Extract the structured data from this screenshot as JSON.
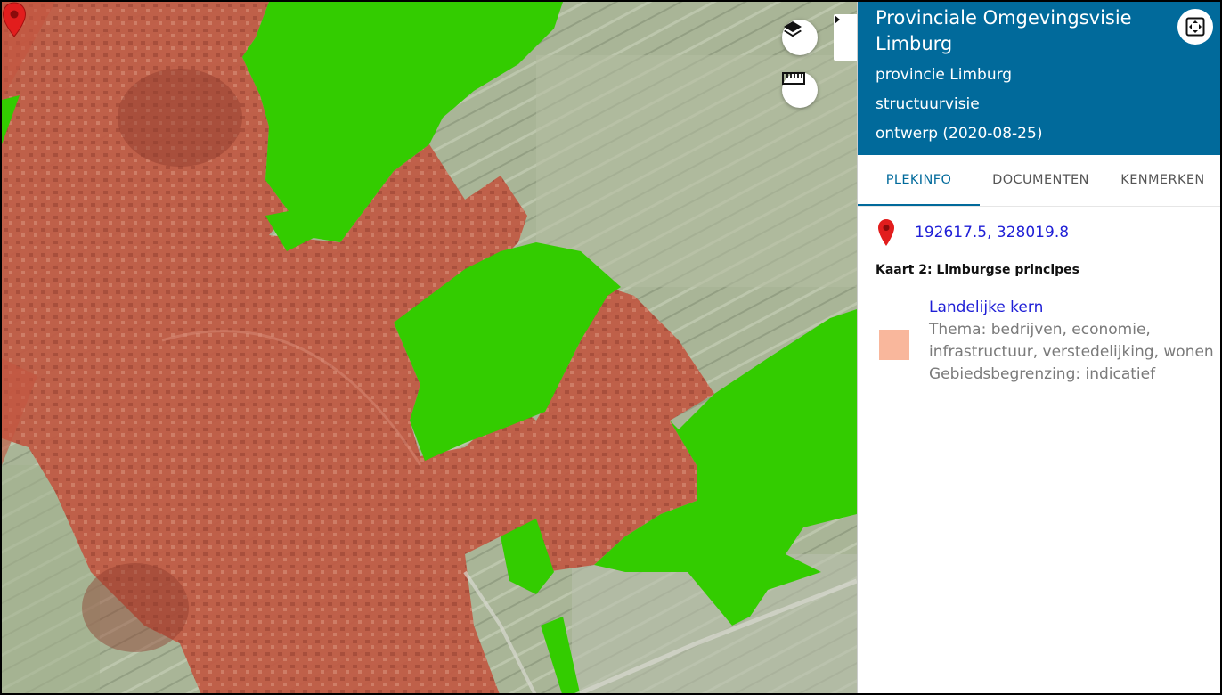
{
  "panel": {
    "title": "Provinciale Omgevingsvisie Limburg",
    "owner": "provincie Limburg",
    "type": "structuurvisie",
    "status": "ontwerp (2020-08-25)"
  },
  "tabs": [
    {
      "label": "PLEKINFO",
      "active": true
    },
    {
      "label": "DOCUMENTEN",
      "active": false
    },
    {
      "label": "KENMERKEN",
      "active": false
    }
  ],
  "location": {
    "coordinates": "192617.5, 328019.8"
  },
  "map_section": {
    "heading": "Kaart 2: Limburgse principes"
  },
  "legend_item": {
    "name": "Landelijke kern",
    "theme": "Thema: bedrijven, economie, infrastructuur, verstedelijking, wonen",
    "boundary": "Gebiedsbegrenzing: indicatief",
    "swatch_color": "#f9b79c"
  },
  "colors": {
    "header_bg": "#016a9b",
    "green_area": "#33cc00",
    "red_area": "#c5553f",
    "marker": "#e21d1d"
  },
  "icons": {
    "layers": "layers-icon",
    "measure": "ruler-icon",
    "collapse": "chevron-right-icon",
    "expand": "fullscreen-icon",
    "pin": "map-pin-icon"
  }
}
